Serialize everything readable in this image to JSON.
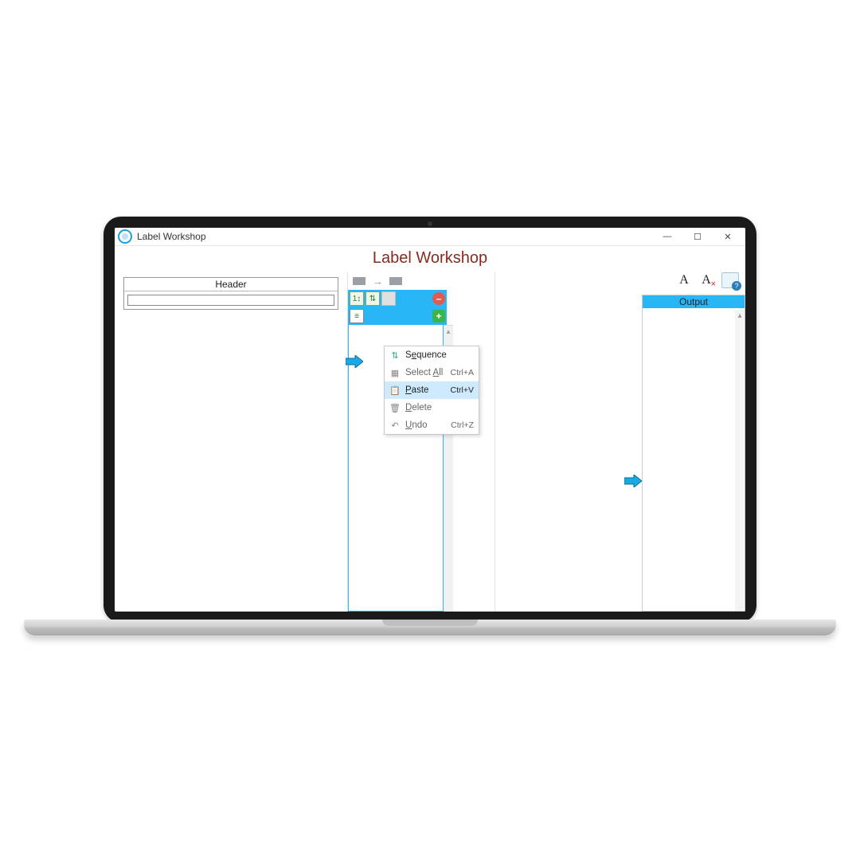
{
  "window": {
    "title": "Label Workshop"
  },
  "heading": "Label Workshop",
  "left_panel": {
    "header_label": "Header"
  },
  "right_panel": {
    "output_label": "Output"
  },
  "right_tools": {
    "font": "A",
    "clear_font": "A"
  },
  "context_menu": {
    "items": [
      {
        "icon": "sequence",
        "label_pre": "S",
        "label_u": "e",
        "label_post": "quence",
        "shortcut": "",
        "enabled": true,
        "selected": false
      },
      {
        "icon": "grid",
        "label_pre": "Select ",
        "label_u": "A",
        "label_post": "ll",
        "shortcut": "Ctrl+A",
        "enabled": false,
        "selected": false
      },
      {
        "icon": "paste",
        "label_pre": "",
        "label_u": "P",
        "label_post": "aste",
        "shortcut": "Ctrl+V",
        "enabled": true,
        "selected": true
      },
      {
        "icon": "trash",
        "label_pre": "",
        "label_u": "D",
        "label_post": "elete",
        "shortcut": "",
        "enabled": false,
        "selected": false
      },
      {
        "icon": "undo",
        "label_pre": "",
        "label_u": "U",
        "label_post": "ndo",
        "shortcut": "Ctrl+Z",
        "enabled": false,
        "selected": false
      }
    ]
  },
  "colors": {
    "accent": "#29b6f6",
    "heading": "#8a2a1f"
  }
}
